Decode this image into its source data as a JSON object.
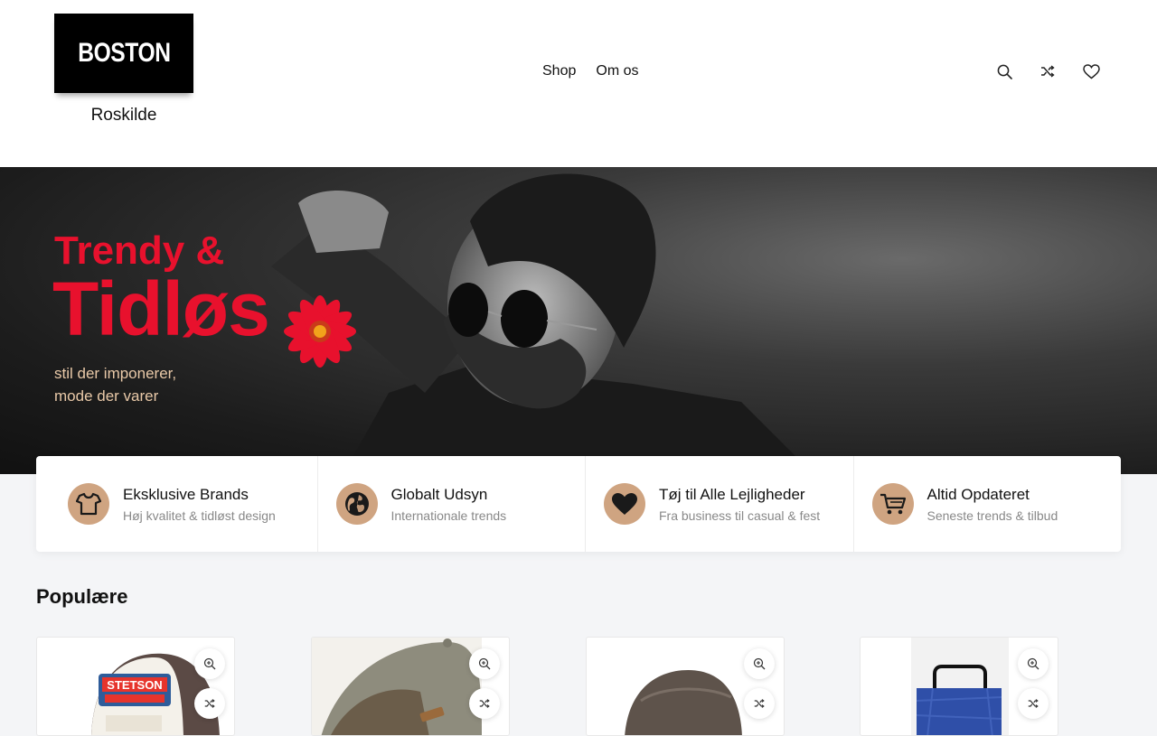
{
  "header": {
    "logo_text": "BOSTON",
    "logo_sub": "Roskilde",
    "nav": [
      {
        "label": "Shop"
      },
      {
        "label": "Om os"
      }
    ],
    "icons": [
      "search-icon",
      "shuffle-icon",
      "heart-icon"
    ]
  },
  "hero": {
    "title_line1": "Trendy &",
    "title_line2": "Tidløs",
    "subtitle_line1": "stil der imponerer,",
    "subtitle_line2": "mode der varer"
  },
  "features": [
    {
      "icon": "tshirt-icon",
      "title": "Eksklusive Brands",
      "desc": "Høj kvalitet & tidløst design"
    },
    {
      "icon": "globe-icon",
      "title": "Globalt Udsyn",
      "desc": "Internationale trends"
    },
    {
      "icon": "heart-icon",
      "title": "Tøj til Alle Lejligheder",
      "desc": "Fra business til casual & fest"
    },
    {
      "icon": "cart-icon",
      "title": "Altid Opdateret",
      "desc": "Seneste trends & tilbud"
    }
  ],
  "popular": {
    "title": "Populære",
    "products": [
      {
        "image": "trucker-cap-image"
      },
      {
        "image": "baseball-cap-image"
      },
      {
        "image": "flat-cap-image"
      },
      {
        "image": "tote-bag-image"
      }
    ]
  },
  "colors": {
    "accent_red": "#e8112d",
    "feature_icon_bg": "#cfa481",
    "hero_subtitle": "#e9c9a8"
  }
}
